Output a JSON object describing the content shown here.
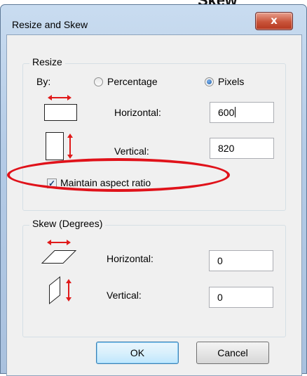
{
  "window": {
    "title": "Resize and Skew",
    "close_glyph": "x"
  },
  "clipped_text": "Skew",
  "resize": {
    "legend": "Resize",
    "by_label": "By:",
    "options": [
      {
        "label": "Percentage",
        "selected": false
      },
      {
        "label": "Pixels",
        "selected": true
      }
    ],
    "horizontal": {
      "label": "Horizontal:",
      "value": "600"
    },
    "vertical": {
      "label": "Vertical:",
      "value": "820"
    },
    "maintain_aspect": {
      "label": "Maintain aspect ratio",
      "checked": true
    }
  },
  "skew": {
    "legend": "Skew (Degrees)",
    "horizontal": {
      "label": "Horizontal:",
      "value": "0"
    },
    "vertical": {
      "label": "Vertical:",
      "value": "0"
    }
  },
  "buttons": {
    "ok": "OK",
    "cancel": "Cancel"
  },
  "icons": {
    "resize_horizontal": "resize-horizontal-icon",
    "resize_vertical": "resize-vertical-icon",
    "skew_horizontal": "skew-horizontal-icon",
    "skew_vertical": "skew-vertical-icon"
  },
  "colors": {
    "arrow": "#e01a1a",
    "highlight": "#e0121a"
  }
}
